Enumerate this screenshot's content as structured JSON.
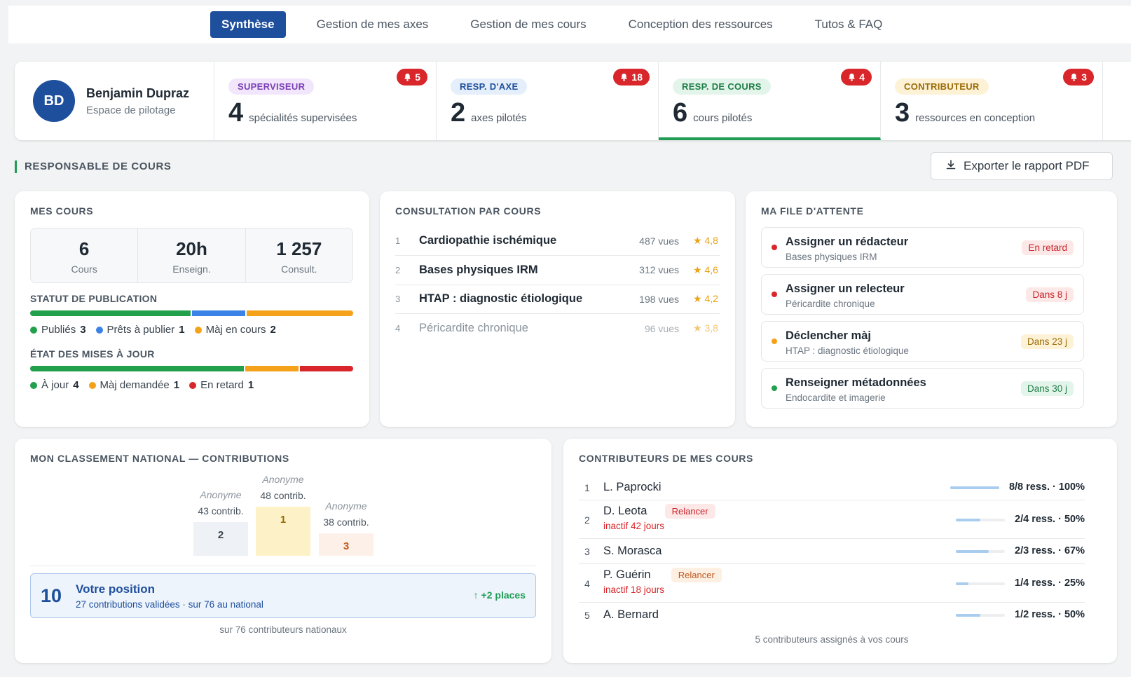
{
  "nav": {
    "tabs": [
      "Synthèse",
      "Gestion de mes axes",
      "Gestion de mes cours",
      "Conception des ressources",
      "Tutos & FAQ"
    ],
    "active_tab": 0
  },
  "user": {
    "initials": "BD",
    "name": "Benjamin Dupraz",
    "subtitle": "Espace de pilotage",
    "avatar_color": "#1e4f9c"
  },
  "roles": [
    {
      "label": "SUPERVISEUR",
      "count": "4",
      "desc": "spécialités supervisées",
      "notif": "5",
      "pill_bg": "#f1e6fb",
      "pill_color": "#7a3fb6"
    },
    {
      "label": "RESP. D'AXE",
      "count": "2",
      "desc": "axes pilotés",
      "notif": "18",
      "pill_bg": "#e5eefb",
      "pill_color": "#1e4f9c"
    },
    {
      "label": "RESP. DE COURS",
      "count": "6",
      "desc": "cours pilotés",
      "notif": "4",
      "pill_bg": "#e3f5ea",
      "pill_color": "#1f7d47"
    },
    {
      "label": "CONTRIBUTEUR",
      "count": "3",
      "desc": "ressources en conception",
      "notif": "3",
      "pill_bg": "#fdf2d6",
      "pill_color": "#9a6b07"
    }
  ],
  "active_role": 2,
  "section": {
    "title": "RESPONSABLE DE COURS",
    "export_label": "Exporter le rapport PDF"
  },
  "mes_cours": {
    "title": "MES COURS",
    "stats": [
      {
        "value": "6",
        "label": "Cours"
      },
      {
        "value": "20h",
        "label": "Enseign."
      },
      {
        "value": "1 257",
        "label": "Consult."
      }
    ],
    "publication": {
      "title": "STATUT DE PUBLICATION",
      "items": [
        {
          "label": "Publiés",
          "value": 3,
          "color": "#22a04b"
        },
        {
          "label": "Prêts à publier",
          "value": 1,
          "color": "#3b82e6"
        },
        {
          "label": "Màj en cours",
          "value": 2,
          "color": "#f5a21b"
        }
      ]
    },
    "updates": {
      "title": "ÉTAT DES MISES À JOUR",
      "items": [
        {
          "label": "À jour",
          "value": 4,
          "color": "#22a04b"
        },
        {
          "label": "Màj demandée",
          "value": 1,
          "color": "#f5a21b"
        },
        {
          "label": "En retard",
          "value": 1,
          "color": "#d8262b"
        }
      ]
    }
  },
  "consultation": {
    "title": "CONSULTATION PAR COURS",
    "rows": [
      {
        "rank": "1",
        "name": "Cardiopathie ischémique",
        "views": "487 vues",
        "rating": "★ 4,8"
      },
      {
        "rank": "2",
        "name": "Bases physiques IRM",
        "views": "312 vues",
        "rating": "★ 4,6"
      },
      {
        "rank": "3",
        "name": "HTAP : diagnostic étiologique",
        "views": "198 vues",
        "rating": "★ 4,2"
      },
      {
        "rank": "4",
        "name": "Péricardite chronique",
        "views": "96 vues",
        "rating": "★ 3,8"
      }
    ]
  },
  "queue": {
    "title": "MA FILE D'ATTENTE",
    "items": [
      {
        "title": "Assigner un rédacteur",
        "subtitle": "Bases physiques IRM",
        "badge": "En retard",
        "dot": "#d8262b",
        "badge_bg": "#fde8e8",
        "badge_color": "#c8242a"
      },
      {
        "title": "Assigner un relecteur",
        "subtitle": "Péricardite chronique",
        "badge": "Dans 8 j",
        "dot": "#d8262b",
        "badge_bg": "#fde8e8",
        "badge_color": "#c8242a"
      },
      {
        "title": "Déclencher màj",
        "subtitle": "HTAP : diagnostic étiologique",
        "badge": "Dans 23 j",
        "dot": "#f5a21b",
        "badge_bg": "#fdf2d6",
        "badge_color": "#9a6b07"
      },
      {
        "title": "Renseigner métadonnées",
        "subtitle": "Endocardite et imagerie",
        "badge": "Dans 30 j",
        "dot": "#22a04b",
        "badge_bg": "#e3f5ea",
        "badge_color": "#1f7d47"
      }
    ]
  },
  "ranking": {
    "title": "MON CLASSEMENT NATIONAL — CONTRIBUTIONS",
    "podium": [
      {
        "place": "2",
        "name": "Anonyme",
        "contrib": "43 contrib.",
        "bg": "#eef1f5",
        "color": "#3a444d"
      },
      {
        "place": "1",
        "name": "Anonyme",
        "contrib": "48 contrib.",
        "bg": "#fdf1c7",
        "color": "#9a6b07"
      },
      {
        "place": "3",
        "name": "Anonyme",
        "contrib": "38 contrib.",
        "bg": "#fdf0e9",
        "color": "#c0561a"
      }
    ],
    "me": {
      "rank": "10",
      "title": "Votre position",
      "subtitle": "27 contributions validées · sur 76 au national",
      "change": "↑ +2 places"
    },
    "footer": "sur 76 contributeurs nationaux"
  },
  "contributors": {
    "title": "CONTRIBUTEURS DE MES COURS",
    "rows": [
      {
        "rank": "1",
        "name": "L. Paprocki",
        "tag": "",
        "sub": "",
        "value": "8/8 ress. · 100%",
        "progress": 1.0
      },
      {
        "rank": "2",
        "name": "D. Leota",
        "tag": "Relancer",
        "sub": "inactif 42 jours",
        "value": "2/4 ress. · 50%",
        "progress": 0.5,
        "tag_bg": "#fde8e8",
        "tag_color": "#c8242a"
      },
      {
        "rank": "3",
        "name": "S. Morasca",
        "tag": "",
        "sub": "",
        "value": "2/3 ress. · 67%",
        "progress": 0.67
      },
      {
        "rank": "4",
        "name": "P. Guérin",
        "tag": "Relancer",
        "sub": "inactif 18 jours",
        "value": "1/4 ress. · 25%",
        "progress": 0.25,
        "tag_bg": "#fdf0e3",
        "tag_color": "#c0561a"
      },
      {
        "rank": "5",
        "name": "A. Bernard",
        "tag": "",
        "sub": "",
        "value": "1/2 ress. · 50%",
        "progress": 0.5
      }
    ],
    "footer": "5 contributeurs assignés à vos cours"
  }
}
